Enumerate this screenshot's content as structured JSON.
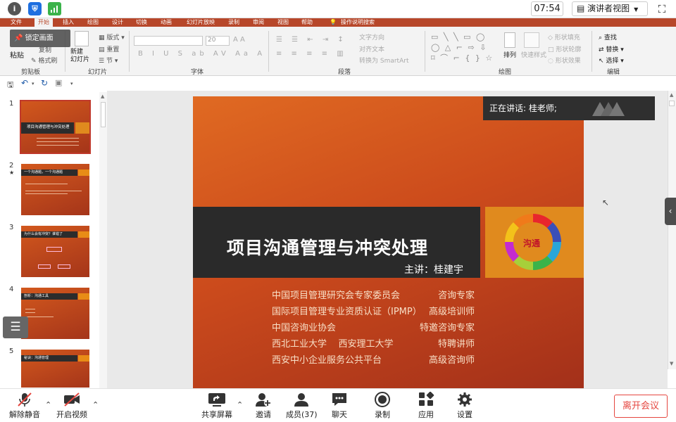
{
  "topbar": {
    "time": "07:54",
    "presenter_view": "演讲者视图",
    "fullscreen_icon": "⛶"
  },
  "menu": [
    "文件",
    "开始",
    "插入",
    "绘图",
    "设计",
    "切换",
    "动画",
    "幻灯片放映",
    "录制",
    "审阅",
    "视图",
    "帮助",
    "操作说明搜索"
  ],
  "ribbon": {
    "lock_label": "锁定画面",
    "paste": "粘贴",
    "copy": "复制",
    "format_painter": "格式刷",
    "new_slide": "新建\n幻灯片",
    "layout": "版式",
    "reset": "重置",
    "section": "节",
    "font_size": "20",
    "text_direction": "文字方向",
    "align_text": "对齐文本",
    "smartart": "转换为 SmartArt",
    "arrange": "排列",
    "quick_styles": "快速样式",
    "shape_fill": "形状填充",
    "shape_outline": "形状轮廓",
    "shape_effects": "形状效果",
    "find": "查找",
    "replace": "替换",
    "select": "选择",
    "groups": [
      "剪贴板",
      "幻灯片",
      "字体",
      "段落",
      "绘图",
      "编辑"
    ]
  },
  "thumbnails": [
    {
      "num": "1",
      "title": "项目沟通管理与冲突处理",
      "selected": true
    },
    {
      "num": "2",
      "title": "一个沟通题，一个沟通题"
    },
    {
      "num": "3",
      "title": "为什么会有冲突？谁错了"
    },
    {
      "num": "4",
      "title": "剖析：沟通工具"
    },
    {
      "num": "5",
      "title": "秘诀：沟通管理"
    }
  ],
  "slide": {
    "title": "项目沟通管理与冲突处理",
    "speaker": "主讲：桂建宇",
    "logo_text": "沟通",
    "credentials": [
      {
        "org": "中国项目管理研究会专家委员会",
        "role": "咨询专家"
      },
      {
        "org": "国际项目管理专业资质认证（IPMP）",
        "role": "高级培训师"
      },
      {
        "org": "中国咨询业协会",
        "role": "特邀咨询专家"
      },
      {
        "org": "西北工业大学    西安理工大学",
        "role": "特聘讲师"
      },
      {
        "org": "西安中小企业服务公共平台",
        "role": "高级咨询师"
      }
    ]
  },
  "speaking_label": "正在讲话: 桂老师;",
  "bottombar": {
    "unmute": "解除静音",
    "start_video": "开启视频",
    "share_screen": "共享屏幕",
    "invite": "邀请",
    "members": "成员(37)",
    "chat": "聊天",
    "record": "录制",
    "apps": "应用",
    "settings": "设置",
    "leave": "离开会议"
  },
  "colors": {
    "accent": "#b7472a",
    "leave": "#e5463f",
    "slide_orange": "#d85a20"
  }
}
